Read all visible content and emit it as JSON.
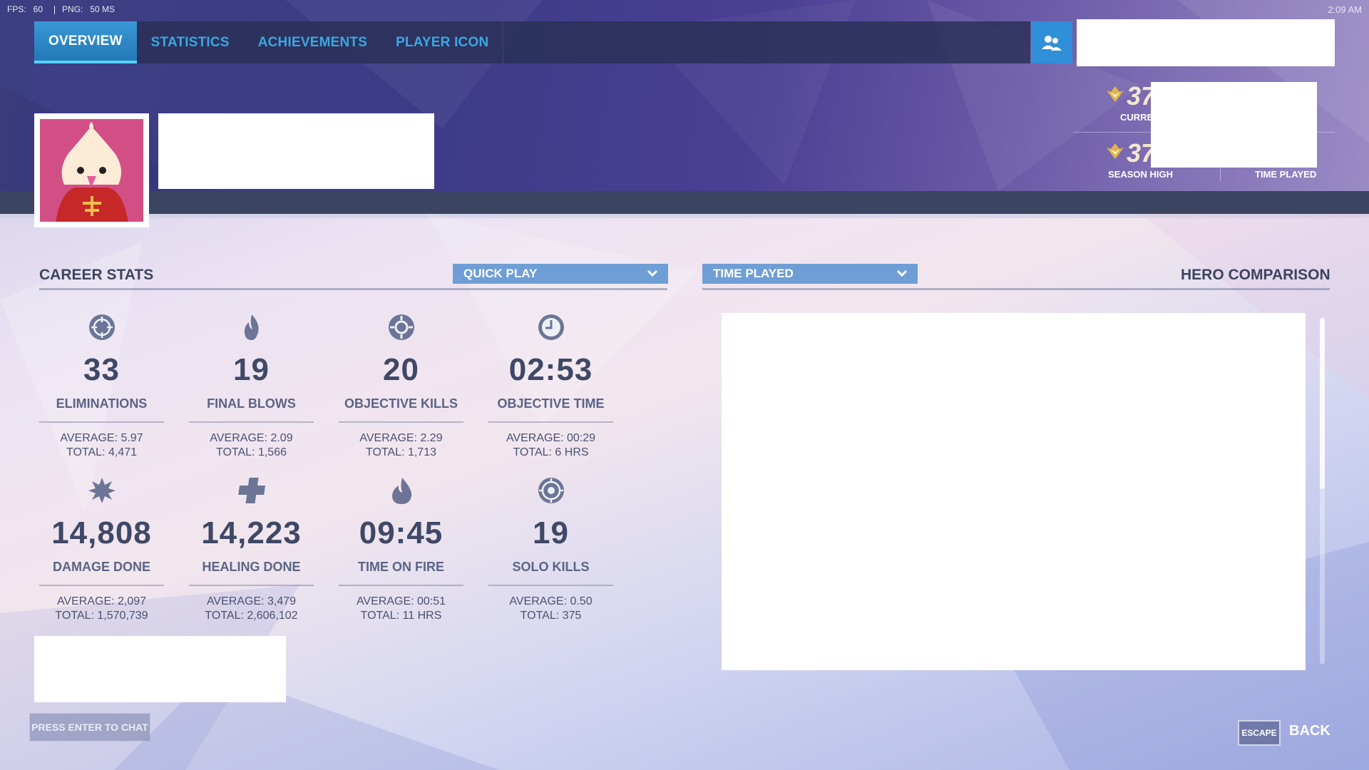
{
  "status": {
    "fps_label": "FPS:",
    "fps_value": "60",
    "ping_label": "PNG:",
    "ping_value": "50 MS",
    "clock": "2:09 AM"
  },
  "nav": {
    "tabs": [
      {
        "label": "OVERVIEW",
        "active": true
      },
      {
        "label": "STATISTICS",
        "active": false
      },
      {
        "label": "ACHIEVEMENTS",
        "active": false
      },
      {
        "label": "PLAYER ICON",
        "active": false
      }
    ]
  },
  "rank": {
    "current_value": "37",
    "current_caption": "CURRE",
    "season_high_value": "37",
    "season_high_caption": "SEASON HIGH",
    "time_played_caption": "TIME PLAYED"
  },
  "career": {
    "title": "CAREER STATS",
    "mode_dropdown": "QUICK PLAY",
    "stats": [
      {
        "icon": "crosshair-icon",
        "value": "33",
        "label": "ELIMINATIONS",
        "average": "AVERAGE: 5.97",
        "total": "TOTAL: 4,471"
      },
      {
        "icon": "flame-icon",
        "value": "19",
        "label": "FINAL BLOWS",
        "average": "AVERAGE: 2.09",
        "total": "TOTAL: 1,566"
      },
      {
        "icon": "objective-icon",
        "value": "20",
        "label": "OBJECTIVE KILLS",
        "average": "AVERAGE: 2.29",
        "total": "TOTAL: 1,713"
      },
      {
        "icon": "clock-icon",
        "value": "02:53",
        "label": "OBJECTIVE TIME",
        "average": "AVERAGE: 00:29",
        "total": "TOTAL: 6 HRS"
      },
      {
        "icon": "burst-icon",
        "value": "14,808",
        "label": "DAMAGE DONE",
        "average": "AVERAGE: 2,097",
        "total": "TOTAL: 1,570,739"
      },
      {
        "icon": "plus-icon",
        "value": "14,223",
        "label": "HEALING DONE",
        "average": "AVERAGE: 3,479",
        "total": "TOTAL: 2,606,102"
      },
      {
        "icon": "fire-drop-icon",
        "value": "09:45",
        "label": "TIME ON FIRE",
        "average": "AVERAGE: 00:51",
        "total": "TOTAL: 11 HRS"
      },
      {
        "icon": "target-icon",
        "value": "19",
        "label": "SOLO KILLS",
        "average": "AVERAGE: 0.50",
        "total": "TOTAL: 375"
      }
    ]
  },
  "hero_comparison": {
    "title": "HERO COMPARISON",
    "sort_dropdown": "TIME PLAYED"
  },
  "chat": {
    "prompt": "PRESS ENTER TO CHAT"
  },
  "footer": {
    "escape_key": "ESCAPE",
    "back_label": "BACK"
  },
  "colors": {
    "accent_blue": "#39a8e4",
    "dropdown_blue": "#6e9ed5",
    "stat_text": "#3f4866"
  }
}
